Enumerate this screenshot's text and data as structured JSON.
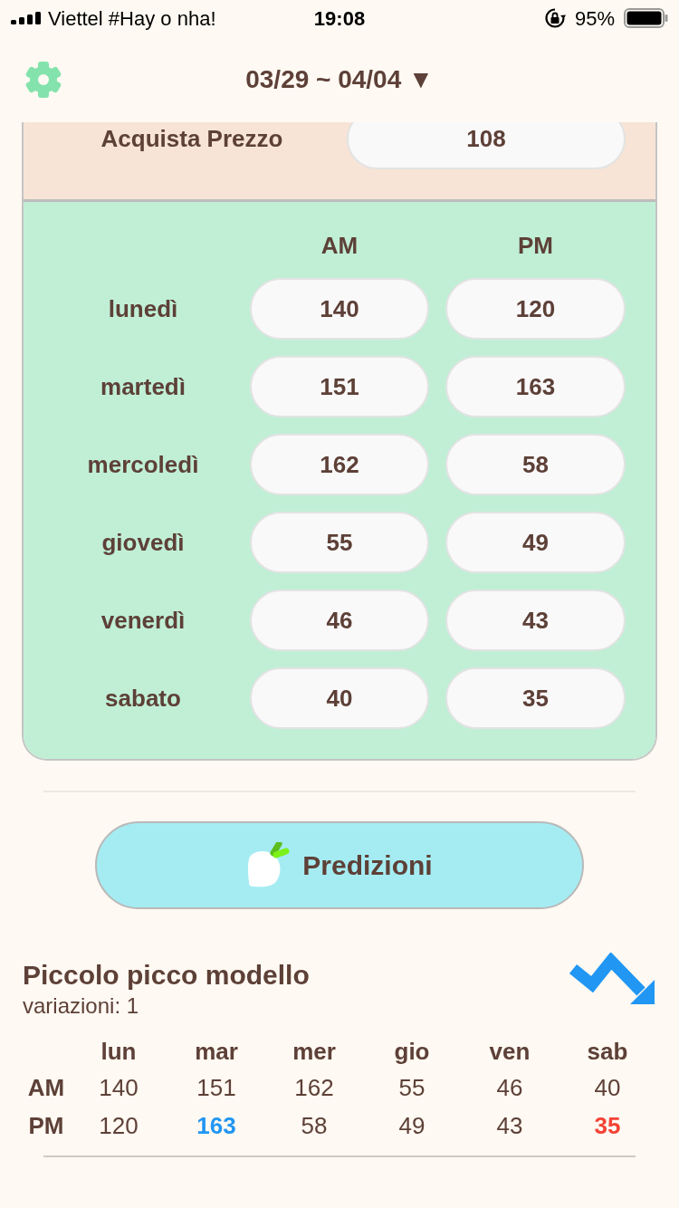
{
  "status_bar": {
    "carrier": "Viettel #Hay o nha!",
    "time": "19:08",
    "battery": "95%"
  },
  "header": {
    "title": "03/29 ~ 04/04 ▼"
  },
  "purchase": {
    "label": "Acquista Prezzo",
    "value": "108"
  },
  "prices": {
    "columns": [
      "AM",
      "PM"
    ],
    "rows": [
      {
        "day": "lunedì",
        "am": "140",
        "pm": "120"
      },
      {
        "day": "martedì",
        "am": "151",
        "pm": "163"
      },
      {
        "day": "mercoledì",
        "am": "162",
        "pm": "58"
      },
      {
        "day": "giovedì",
        "am": "55",
        "pm": "49"
      },
      {
        "day": "venerdì",
        "am": "46",
        "pm": "43"
      },
      {
        "day": "sabato",
        "am": "40",
        "pm": "35"
      }
    ]
  },
  "predict_button": {
    "label": "Predizioni"
  },
  "pattern": {
    "title": "Piccolo picco modello",
    "variations": "variazioni: 1",
    "columns": [
      "lun",
      "mar",
      "mer",
      "gio",
      "ven",
      "sab"
    ],
    "rows": [
      {
        "label": "AM",
        "cells": [
          {
            "value": "140",
            "kind": "plain"
          },
          {
            "value": "151",
            "kind": "plain"
          },
          {
            "value": "162",
            "kind": "plain"
          },
          {
            "value": "55",
            "kind": "plain"
          },
          {
            "value": "46",
            "kind": "plain"
          },
          {
            "value": "40",
            "kind": "plain"
          }
        ]
      },
      {
        "label": "PM",
        "cells": [
          {
            "value": "120",
            "kind": "plain"
          },
          {
            "value": "163",
            "kind": "high"
          },
          {
            "value": "58",
            "kind": "plain"
          },
          {
            "value": "49",
            "kind": "plain"
          },
          {
            "value": "43",
            "kind": "plain"
          },
          {
            "value": "35",
            "kind": "low"
          }
        ]
      }
    ]
  }
}
